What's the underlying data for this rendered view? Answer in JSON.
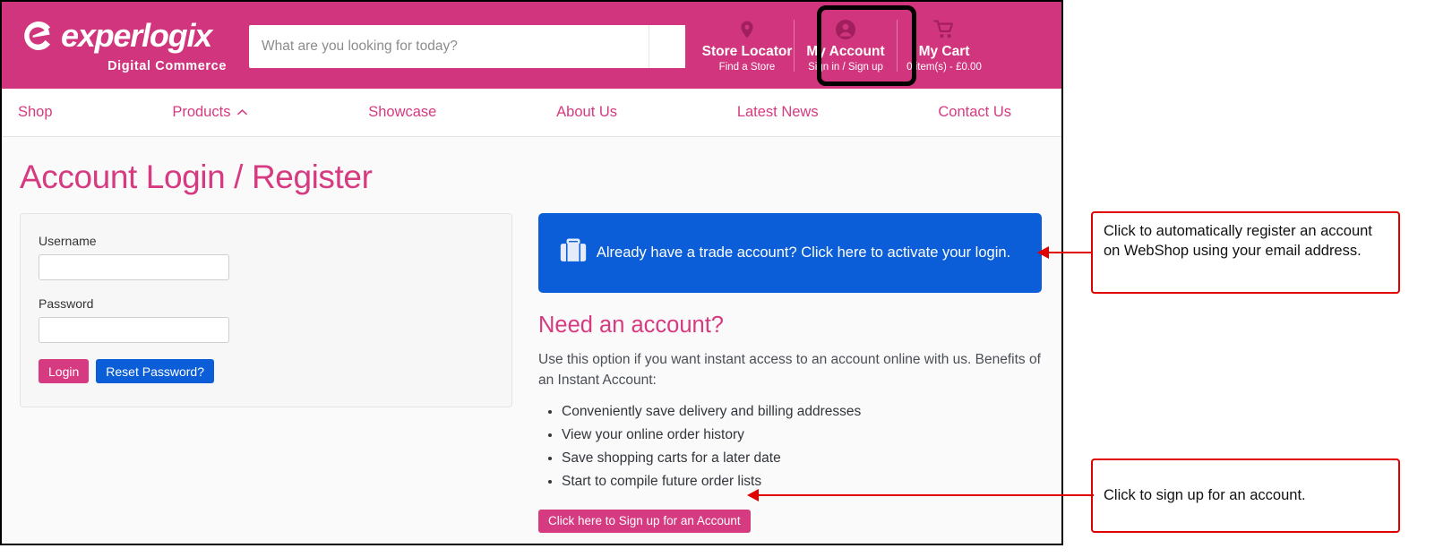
{
  "header": {
    "logo_word": "experlogix",
    "logo_sub": "Digital Commerce",
    "logo_icon": "experlogix-c-mark-icon",
    "search": {
      "placeholder": "What are you looking for today?",
      "value": "",
      "button_icon": "search-icon"
    },
    "utils": [
      {
        "icon": "map-pin-icon",
        "title": "Store Locator",
        "sub": "Find a Store"
      },
      {
        "icon": "user-circle-icon",
        "title": "My Account",
        "sub": "Sign in / Sign up",
        "highlighted": true
      },
      {
        "icon": "shopping-cart-icon",
        "title": "My Cart",
        "sub": "0 item(s) - £0.00"
      }
    ]
  },
  "nav": {
    "items": [
      {
        "label": "Shop",
        "has_chevron": false
      },
      {
        "label": "Products",
        "has_chevron": true,
        "chevron_icon": "chevron-up-icon"
      },
      {
        "label": "Showcase",
        "has_chevron": false
      },
      {
        "label": "About Us",
        "has_chevron": false
      },
      {
        "label": "Latest News",
        "has_chevron": false
      },
      {
        "label": "Contact Us",
        "has_chevron": false
      }
    ]
  },
  "page": {
    "title": "Account Login / Register"
  },
  "login": {
    "username_label": "Username",
    "username_value": "",
    "password_label": "Password",
    "password_value": "",
    "login_button": "Login",
    "reset_button": "Reset Password?"
  },
  "trade_banner": {
    "icon": "briefcase-icon",
    "text": "Already have a trade account? Click here to activate your login."
  },
  "need_account": {
    "heading": "Need an account?",
    "intro": "Use this option if you want instant access to an account online with us. Benefits of an Instant Account:",
    "benefits": [
      "Conveniently save delivery and billing addresses",
      "View your online order history",
      "Save shopping carts for a later date",
      "Start to compile future order lists"
    ],
    "signup_button": "Click here to Sign up for an Account"
  },
  "annotations": [
    {
      "text": "Click to automatically register an account on WebShop using your email address."
    },
    {
      "text": "Click to sign up for an account."
    }
  ],
  "colors": {
    "brand_pink": "#d0357d",
    "link_pink": "#d63a80",
    "accent_blue": "#0b5ed7",
    "annotation_red": "#e00000",
    "page_background": "#fafafa"
  }
}
